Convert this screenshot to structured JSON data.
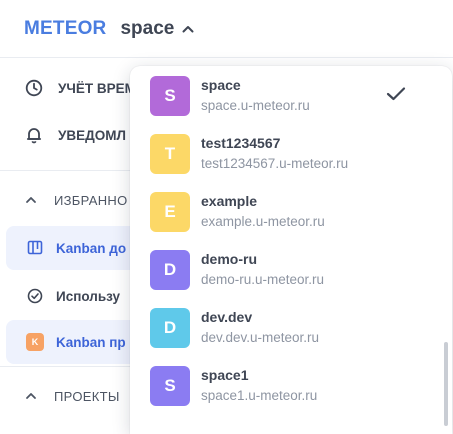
{
  "header": {
    "logo": "METEOR",
    "space_name": "space"
  },
  "sidebar": {
    "items": [
      {
        "label": "УЧЁТ ВРЕМ",
        "icon": "clock-icon"
      },
      {
        "label": "УВЕДОМЛ",
        "icon": "bell-icon"
      }
    ],
    "favorites": {
      "label": "ИЗБРАННО",
      "items": [
        {
          "label": "Kanban до",
          "icon": "board-icon",
          "active": true
        },
        {
          "label": "Использу",
          "icon": "check-circle-icon",
          "active": false
        },
        {
          "label": "Kanban пр",
          "icon": "k-badge-icon",
          "badge": "K",
          "active": true
        }
      ]
    },
    "projects": {
      "label": "ПРОЕКТЫ"
    }
  },
  "dropdown": {
    "workspaces": [
      {
        "letter": "S",
        "name": "space",
        "domain": "space.u-meteor.ru",
        "color": "#b26ad9",
        "selected": true
      },
      {
        "letter": "T",
        "name": "test1234567",
        "domain": "test1234567.u-meteor.ru",
        "color": "#fcd867",
        "selected": false
      },
      {
        "letter": "E",
        "name": "example",
        "domain": "example.u-meteor.ru",
        "color": "#fcd867",
        "selected": false
      },
      {
        "letter": "D",
        "name": "demo-ru",
        "domain": "demo-ru.u-meteor.ru",
        "color": "#8b7cf2",
        "selected": false
      },
      {
        "letter": "D",
        "name": "dev.dev",
        "domain": "dev.dev.u-meteor.ru",
        "color": "#5fc9ea",
        "selected": false
      },
      {
        "letter": "S",
        "name": "space1",
        "domain": "space1.u-meteor.ru",
        "color": "#8b7cf2",
        "selected": false
      }
    ]
  },
  "colors": {
    "brand": "#4a7de0",
    "active_bg": "#eef2fd",
    "active_text": "#3d64d8"
  }
}
